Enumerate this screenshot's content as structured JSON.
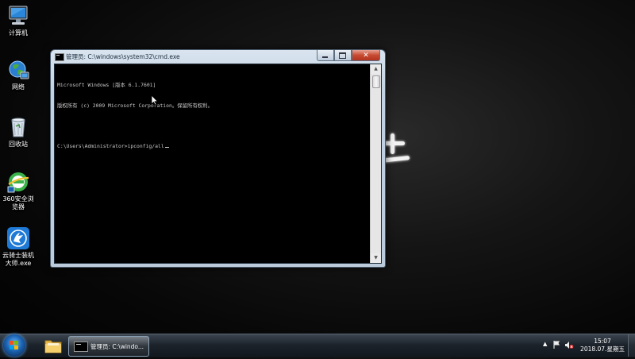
{
  "desktop": {
    "icons": [
      {
        "label": "计算机",
        "icon": "computer-icon"
      },
      {
        "label": "网络",
        "icon": "network-icon"
      },
      {
        "label": "回收站",
        "icon": "recycle-bin-icon"
      },
      {
        "label": "360安全浏览器",
        "icon": "360-browser-icon"
      },
      {
        "label": "云骑士装机大师.exe",
        "icon": "yunqishi-installer-icon"
      }
    ]
  },
  "cmd_window": {
    "title": "管理员: C:\\windows\\system32\\cmd.exe",
    "lines": [
      "Microsoft Windows [版本 6.1.7601]",
      "版权所有 (c) 2009 Microsoft Corporation。保留所有权利。",
      "",
      "C:\\Users\\Administrator>ipconfig/all"
    ],
    "buttons": {
      "minimize": "minimize",
      "maximize": "maximize",
      "close": "✕"
    }
  },
  "taskbar": {
    "task_label": "管理员: C:\\windo...",
    "time": "15:07",
    "date": "2018.07.星期五",
    "tray_arrow": "▲"
  },
  "colors": {
    "console_bg": "#000000",
    "console_text": "#c8c8c8",
    "close_button": "#c74b32",
    "taskbar": "#1c232b"
  }
}
